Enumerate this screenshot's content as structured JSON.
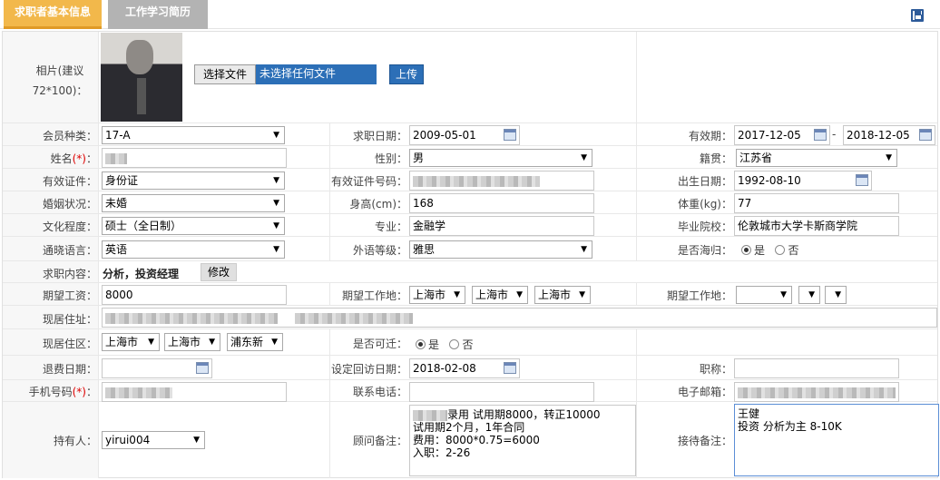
{
  "tabs": [
    "求职者基本信息",
    "工作学习简历"
  ],
  "photo": {
    "label": "相片(建议72*100)：",
    "file_button": "选择文件",
    "file_status": "未选择任何文件",
    "upload_button": "上传"
  },
  "member_type": {
    "label": "会员种类：",
    "value": "17-A"
  },
  "apply_date": {
    "label": "求职日期：",
    "value": "2009-05-01"
  },
  "valid_period": {
    "label": "有效期：",
    "from": "2017-12-05",
    "sep": "-",
    "to": "2018-12-05"
  },
  "name": {
    "label": "姓名",
    "req": "(*)",
    "colon": "："
  },
  "gender": {
    "label": "性别：",
    "value": "男"
  },
  "native_place": {
    "label": "籍贯：",
    "value": "江苏省"
  },
  "id_type": {
    "label": "有效证件：",
    "value": "身份证"
  },
  "id_number": {
    "label": "有效证件号码："
  },
  "birth_date": {
    "label": "出生日期：",
    "value": "1992-08-10"
  },
  "marital": {
    "label": "婚姻状况：",
    "value": "未婚"
  },
  "height": {
    "label": "身高(cm)：",
    "value": "168"
  },
  "weight": {
    "label": "体重(kg)：",
    "value": "77"
  },
  "education": {
    "label": "文化程度：",
    "value": "硕士（全日制）"
  },
  "major": {
    "label": "专业：",
    "value": "金融学"
  },
  "school": {
    "label": "毕业院校：",
    "value": "伦敦城市大学卡斯商学院"
  },
  "language": {
    "label": "通晓语言：",
    "value": "英语"
  },
  "language_level": {
    "label": "外语等级：",
    "value": "雅思"
  },
  "overseas": {
    "label": "是否海归：",
    "yes": "是",
    "no": "否",
    "selected": "是"
  },
  "job_content": {
    "label": "求职内容：",
    "value": "分析，投资经理",
    "edit_button": "修改"
  },
  "salary": {
    "label": "期望工资：",
    "value": "8000"
  },
  "work_place_1": {
    "label": "期望工作地：",
    "values": [
      "上海市",
      "上海市",
      "上海市"
    ]
  },
  "work_place_2": {
    "label": "期望工作地："
  },
  "address": {
    "label": "现居住址："
  },
  "district": {
    "label": "现居住区：",
    "values": [
      "上海市",
      "上海市",
      "浦东新"
    ]
  },
  "relocate": {
    "label": "是否可迁：",
    "yes": "是",
    "no": "否",
    "selected": "是"
  },
  "refund_date": {
    "label": "退费日期：",
    "value": ""
  },
  "revisit_date": {
    "label": "设定回访日期：",
    "value": "2018-02-08"
  },
  "title": {
    "label": "职称：",
    "value": ""
  },
  "mobile": {
    "label": "手机号码",
    "req": "(*)",
    "colon": "："
  },
  "phone": {
    "label": "联系电话：",
    "value": ""
  },
  "email": {
    "label": "电子邮箱："
  },
  "holder": {
    "label": "持有人：",
    "value": "yirui004"
  },
  "consultant_note": {
    "label": "顾问备注：",
    "prefix": "录用 试用期8000，转正10000",
    "lines": "试用期2个月，1年合同\n费用：8000*0.75=6000\n入职：2-26"
  },
  "reception_note": {
    "label": "接待备注：",
    "value": "王健\n投资 分析为主 8-10K"
  }
}
